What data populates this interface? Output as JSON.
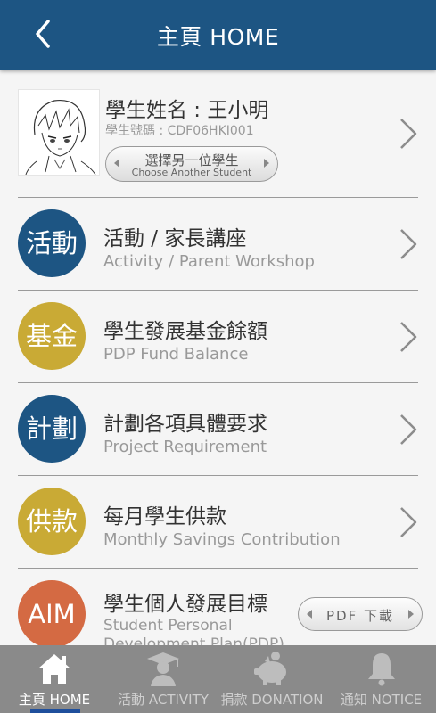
{
  "header": {
    "title": "主頁 HOME"
  },
  "student": {
    "name": "學生姓名 : 王小明",
    "id": "學生號碼 : CDF06HKI001",
    "choose_zh": "選擇另一位學生",
    "choose_en": "Choose Another Student"
  },
  "menu": [
    {
      "badge": "活動",
      "title": "活動 / 家長講座",
      "subtitle": "Activity / Parent Workshop",
      "color": "#1d5583"
    },
    {
      "badge": "基金",
      "title": "學生發展基金餘額",
      "subtitle": "PDP Fund Balance",
      "color": "#c9aa35"
    },
    {
      "badge": "計劃",
      "title": "計劃各項具體要求",
      "subtitle": "Project Requirement",
      "color": "#1d5583"
    },
    {
      "badge": "供款",
      "title": "每月學生供款",
      "subtitle": "Monthly Savings Contribution",
      "color": "#c9aa35"
    },
    {
      "badge": "AIM",
      "title": "學生個人發展目標",
      "subtitle_line1": "Student Personal",
      "subtitle_line2": "Development Plan(PDP)",
      "pdf_label": "PDF 下載",
      "color": "#d46a43"
    }
  ],
  "tabs": [
    {
      "label": "主頁 HOME",
      "icon": "home-icon",
      "active": true
    },
    {
      "label": "活動 ACTIVITY",
      "icon": "graduate-icon",
      "active": false
    },
    {
      "label": "捐款 DONATION",
      "icon": "piggy-bank-icon",
      "active": false
    },
    {
      "label": "通知 NOTICE",
      "icon": "bell-icon",
      "active": false
    }
  ]
}
